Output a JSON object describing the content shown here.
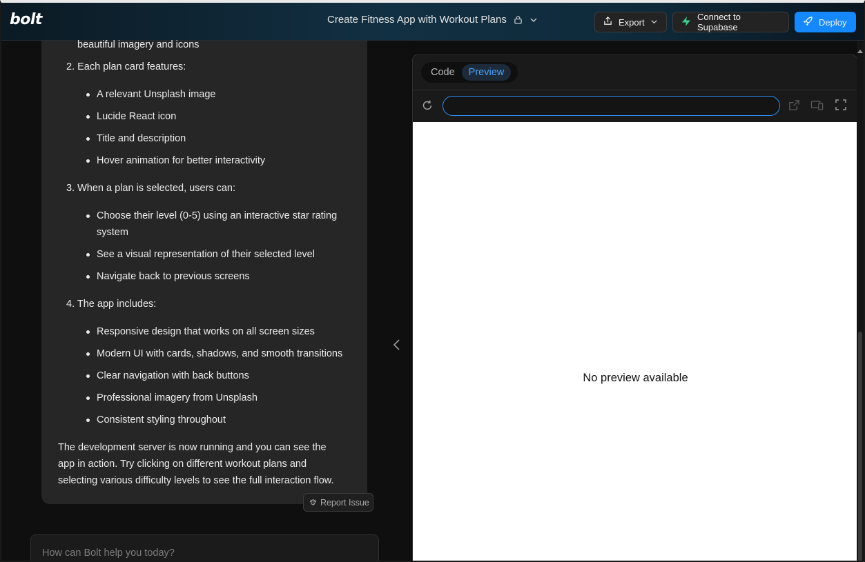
{
  "app": {
    "logo": "bolt",
    "project_title": "Create Fitness App with Workout Plans"
  },
  "toolbar": {
    "export_label": "Export",
    "supabase_label": "Connect to Supabase",
    "deploy_label": "Deploy"
  },
  "chat": {
    "cut_line": "beautiful imagery and icons",
    "sections": [
      {
        "heading": "2. Each plan card features:",
        "bullets": [
          "A relevant Unsplash image",
          "Lucide React icon",
          "Title and description",
          "Hover animation for better interactivity"
        ]
      },
      {
        "heading": "3. When a plan is selected, users can:",
        "bullets": [
          "Choose their level (0-5) using an interactive star rating",
          "system",
          "See a visual representation of their selected level",
          "Navigate back to previous screens"
        ]
      },
      {
        "heading": "4. The app includes:",
        "bullets": [
          "Responsive design that works on all screen sizes",
          "Modern UI with cards, shadows, and smooth transitions",
          "Clear navigation with back buttons",
          "Professional imagery from Unsplash",
          "Consistent styling throughout"
        ]
      }
    ],
    "closing": [
      "The development server is now running and you can see the",
      "app in action. Try clicking on different workout plans and",
      "selecting various difficulty levels to see the full interaction flow."
    ],
    "report_label": "Report Issue",
    "input_placeholder": "How can Bolt help you today?"
  },
  "preview": {
    "tab_code": "Code",
    "tab_preview": "Preview",
    "url_value": "",
    "empty_message": "No preview available"
  },
  "colors": {
    "accent": "#1488fc",
    "supabase_green": "#3ecf8e",
    "chat_card": "#262626"
  }
}
